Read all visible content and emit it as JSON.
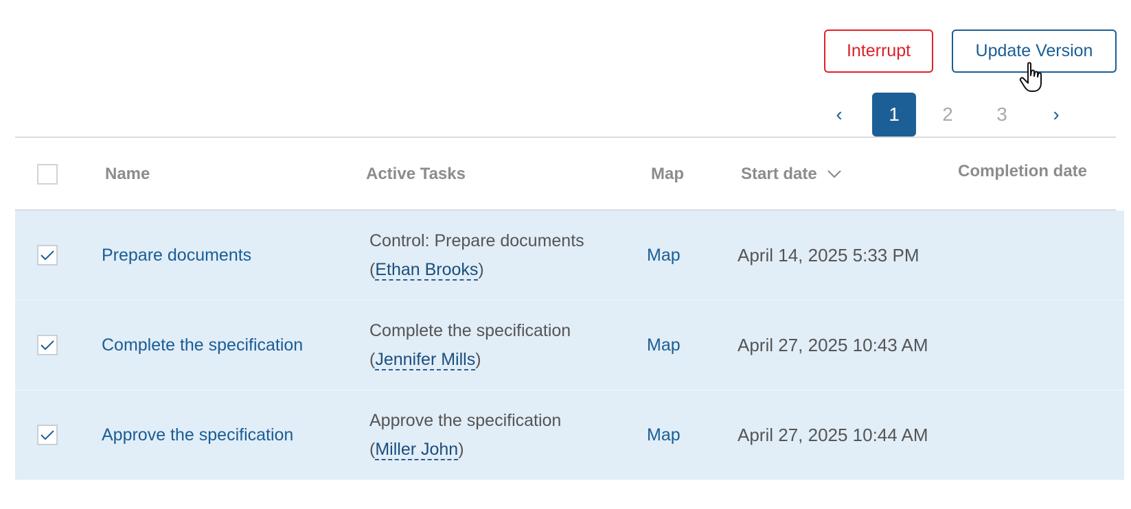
{
  "actions": {
    "interrupt_label": "Interrupt",
    "update_version_label": "Update Version"
  },
  "pagination": {
    "prev": "‹",
    "pages": [
      "1",
      "2",
      "3"
    ],
    "current": "1",
    "next": "›"
  },
  "table": {
    "headers": {
      "name": "Name",
      "active_tasks": "Active Tasks",
      "map": "Map",
      "start_date": "Start date",
      "completion_date": "Completion date"
    },
    "sort": {
      "column": "start_date",
      "direction": "descending",
      "icon": "chevron-down-icon"
    },
    "rows": [
      {
        "selected": true,
        "name": "Prepare documents",
        "task": "Control: Prepare documents",
        "assignee": "Ethan Brooks",
        "map": "Map",
        "start_date": "April 14, 2025 5:33 PM",
        "completion_date": ""
      },
      {
        "selected": true,
        "name": "Complete the specification",
        "task": "Complete the specification",
        "assignee": "Jennifer Mills",
        "map": "Map",
        "start_date": "April 27, 2025 10:43 AM",
        "completion_date": ""
      },
      {
        "selected": true,
        "name": "Approve the specification",
        "task": "Approve the specification",
        "assignee": "Miller John",
        "map": "Map",
        "start_date": "April 27, 2025 10:44 AM",
        "completion_date": ""
      }
    ]
  },
  "colors": {
    "primary": "#1a5d95",
    "danger": "#d9222a",
    "selected_row_bg": "#e1edf7",
    "header_text": "#8c8c8c"
  }
}
